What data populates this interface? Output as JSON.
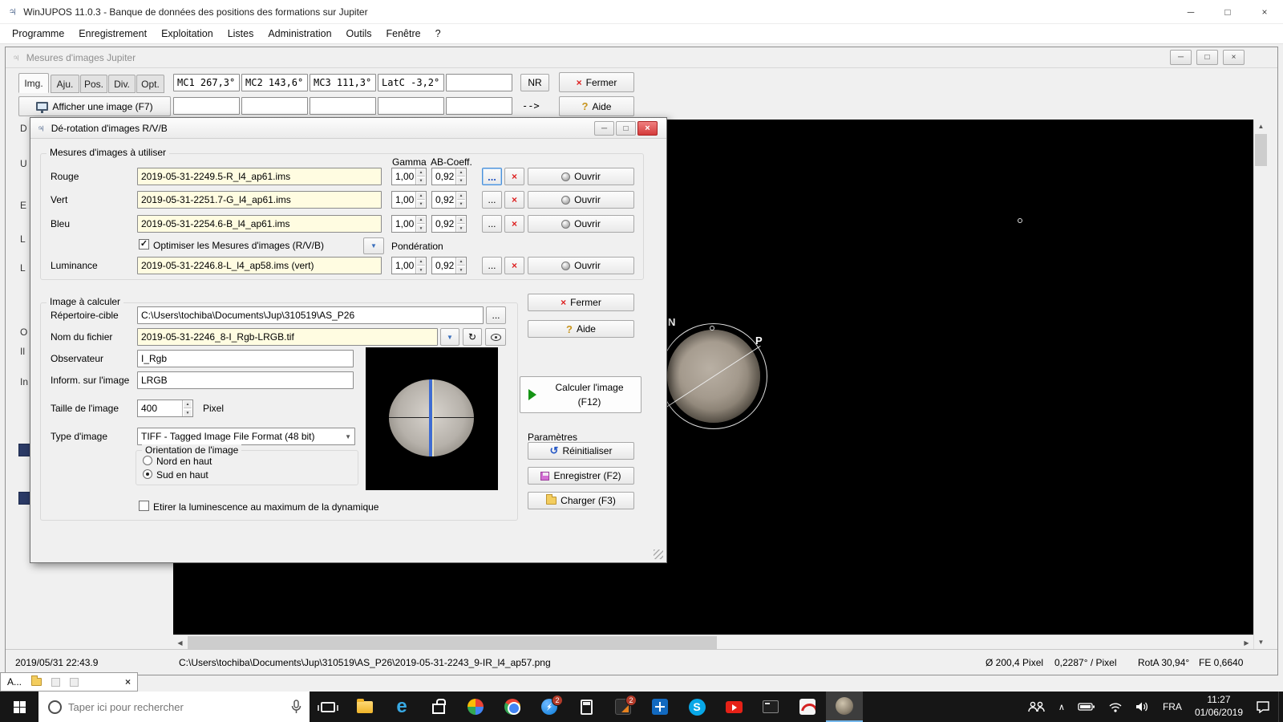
{
  "window": {
    "title": "WinJUPOS 11.0.3 - Banque de données des positions des formations sur Jupiter",
    "menu": [
      "Programme",
      "Enregistrement",
      "Exploitation",
      "Listes",
      "Administration",
      "Outils",
      "Fenêtre",
      "?"
    ]
  },
  "icons": {
    "minimize": "─",
    "maximize": "□",
    "close": "×",
    "check": "✓",
    "dropdown": "▼",
    "spin_up": "▲",
    "spin_down": "▼",
    "scroll_up": "▲",
    "scroll_down": "▼",
    "scroll_left": "◀",
    "scroll_right": "▶",
    "help": "?",
    "reset": "↺",
    "refresh": "↻",
    "chevron": "∧"
  },
  "mdi": {
    "title": "Mesures d'images Jupiter",
    "tabs": [
      "Img.",
      "Aju.",
      "Pos.",
      "Div.",
      "Opt."
    ],
    "coords": [
      "MC1 267,3°",
      "MC2 143,6°",
      "MC3 111,3°",
      "LatC  -3,2°"
    ],
    "nr": "NR",
    "fermer": "Fermer",
    "aide": "Aide",
    "afficher": "Afficher une image (F7)",
    "arrow": "-->",
    "slivers": [
      "D",
      "U",
      "E",
      "L",
      "L",
      "O",
      "Il",
      "In"
    ],
    "list_entry": "2019/05/31  22:43.9",
    "image_labels": {
      "n": "N",
      "p": "P"
    },
    "status": {
      "path": "C:\\Users\\tochiba\\Documents\\Jup\\310519\\AS_P26\\2019-05-31-2243_9-IR_l4_ap57.png",
      "diameter": "Ø 200,4 Pixel",
      "scale": "0,2287° / Pixel",
      "rotation": "RotA 30,94°",
      "fe": "FE 0,6640"
    }
  },
  "dialog": {
    "title": "Dé-rotation d'images R/V/B",
    "group_measures": "Mesures d'images à utiliser",
    "col_gamma": "Gamma",
    "col_ab": "AB-Coeff.",
    "dots": "...",
    "open_label": "Ouvrir",
    "rows": [
      {
        "label": "Rouge",
        "file": "2019-05-31-2249.5-R_l4_ap61.ims",
        "gamma": "1,00",
        "ab": "0,92"
      },
      {
        "label": "Vert",
        "file": "2019-05-31-2251.7-G_l4_ap61.ims",
        "gamma": "1,00",
        "ab": "0,92"
      },
      {
        "label": "Bleu",
        "file": "2019-05-31-2254.6-B_l4_ap61.ims",
        "gamma": "1,00",
        "ab": "0,92"
      }
    ],
    "optimize_label": "Optimiser les Mesures d'images (R/V/B)",
    "ponderation": "Pondération",
    "luminance": {
      "label": "Luminance",
      "file": "2019-05-31-2246.8-L_l4_ap58.ims (vert)",
      "gamma": "1,00",
      "ab": "0,92"
    },
    "group_image": "Image à calculer",
    "fields": {
      "dir_label": "Répertoire-cible",
      "dir_value": "C:\\Users\\tochiba\\Documents\\Jup\\310519\\AS_P26",
      "name_label": "Nom du fichier",
      "name_value": "2019-05-31-2246_8-I_Rgb-LRGB.tif",
      "obs_label": "Observateur",
      "obs_value": "I_Rgb",
      "info_label": "Inform. sur l'image",
      "info_value": "LRGB",
      "size_label": "Taille de l'image",
      "size_value": "400",
      "size_unit": "Pixel",
      "type_label": "Type d'image",
      "type_value": "TIFF - Tagged Image File Format (48 bit)"
    },
    "orientation": {
      "label": "Orientation de l'image",
      "north": "Nord en haut",
      "south": "Sud en haut"
    },
    "stretch_label": "Etirer la luminescence au maximum de la dynamique",
    "buttons": {
      "fermer": "Fermer",
      "aide": "Aide",
      "calc_line1": "Calculer l'image",
      "calc_line2": "(F12)",
      "params": "Paramètres",
      "reset": "Réinitialiser",
      "save": "Enregistrer (F2)",
      "load": "Charger (F3)"
    }
  },
  "mini_window": {
    "title": "A..."
  },
  "taskbar": {
    "search_placeholder": "Taper ici pour rechercher",
    "badge": "2",
    "edge_letter": "e",
    "skype_letter": "S",
    "lang": "FRA",
    "time": "11:27",
    "date": "01/06/2019"
  }
}
